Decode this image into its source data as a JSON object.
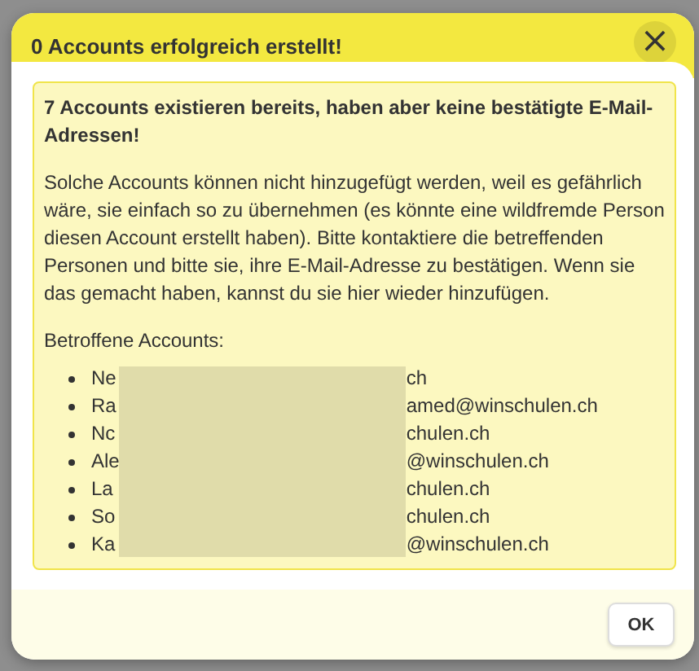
{
  "dialog": {
    "title": "0 Accounts erfolgreich erstellt!",
    "close": "×",
    "notice": {
      "heading": "7 Accounts existieren bereits, haben aber keine bestätigte E-Mail-Adressen!",
      "body": "Solche Accounts können nicht hinzugefügt werden, weil es gefährlich wäre, sie einfach so zu übernehmen (es könnte eine wildfremde Person diesen Account erstellt haben). Bitte kontaktiere die betreffenden Personen und bitte sie, ihre E-Mail-Adresse zu bestätigen. Wenn sie das gemacht haben, kannst du sie hier wieder hinzufügen.",
      "list_label": "Betroffene Accounts:",
      "accounts": [
        {
          "start": "Ne",
          "end": "ch"
        },
        {
          "start": "Ra",
          "end": "amed@winschulen.ch"
        },
        {
          "start": "Nc",
          "end": "chulen.ch"
        },
        {
          "start": "Ale",
          "end": "@winschulen.ch"
        },
        {
          "start": "La",
          "end": "chulen.ch"
        },
        {
          "start": "So",
          "end": "chulen.ch"
        },
        {
          "start": "Ka",
          "end": "@winschulen.ch"
        }
      ]
    },
    "buttons": [
      "OK"
    ]
  }
}
